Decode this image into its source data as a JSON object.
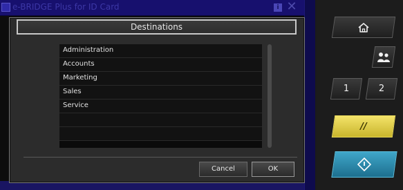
{
  "app": {
    "title": "e-BRIDGE Plus for ID Card",
    "info_glyph": "i",
    "close_glyph": "✕"
  },
  "dialog": {
    "title": "Destinations",
    "items": [
      {
        "label": "Administration"
      },
      {
        "label": "Accounts"
      },
      {
        "label": "Marketing"
      },
      {
        "label": "Sales"
      },
      {
        "label": "Service"
      },
      {
        "label": ""
      },
      {
        "label": ""
      }
    ],
    "cancel_label": "Cancel",
    "ok_label": "OK"
  },
  "panel": {
    "one_label": "1",
    "two_label": "2",
    "reset_glyph": "//",
    "icons": {
      "home": "home-icon",
      "users": "users-icon",
      "start": "start-diamond-icon"
    },
    "colors": {
      "reset": "#e8d64c",
      "start": "#2f8fb3"
    }
  }
}
